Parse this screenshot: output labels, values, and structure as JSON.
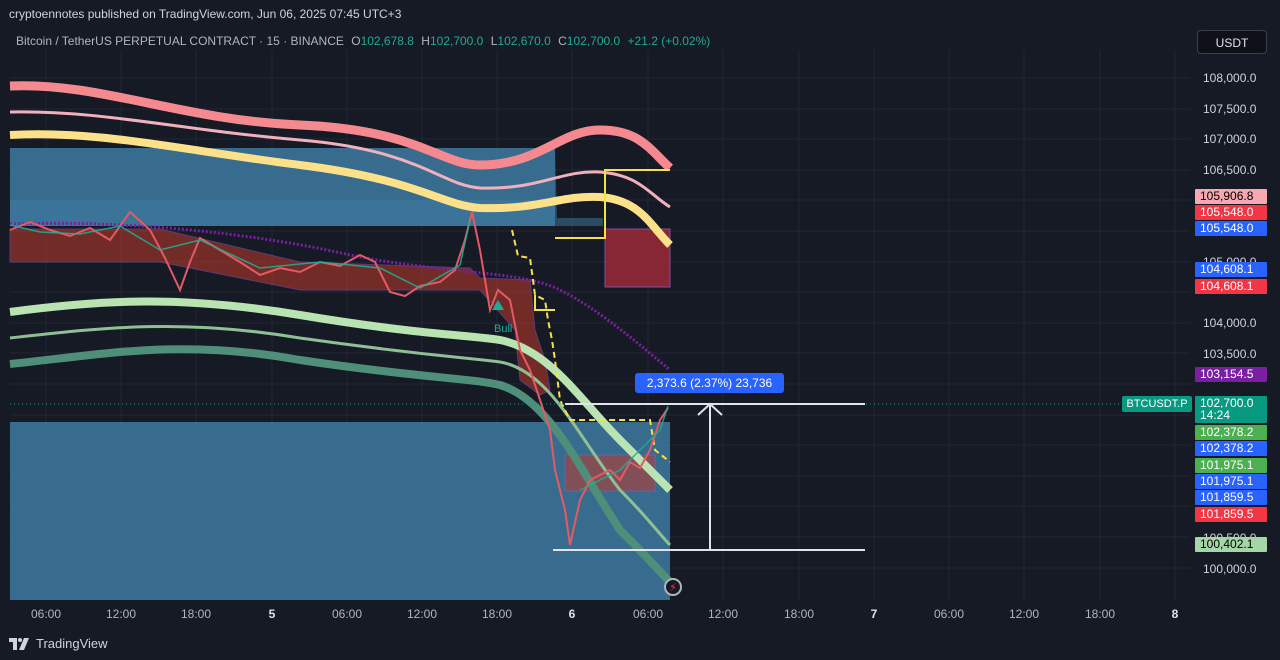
{
  "header": {
    "publisher_line": "cryptoennotes published on TradingView.com, Jun 06, 2025 07:45 UTC+3"
  },
  "legend": {
    "symbol": "Bitcoin / TetherUS PERPETUAL CONTRACT · 15 · BINANCE",
    "o_label": "O",
    "o_value": "102,678.8",
    "h_label": "H",
    "h_value": "102,700.0",
    "l_label": "L",
    "l_value": "102,670.0",
    "c_label": "C",
    "c_value": "102,700.0",
    "change": "+21.2 (+0.02%)"
  },
  "currency_button": "USDT",
  "y_axis_ticks": [
    "108,000.0",
    "107,500.0",
    "107,000.0",
    "106,500.0",
    "105,000.0",
    "104,000.0",
    "103,500.0",
    "100,500.0",
    "100,000.0"
  ],
  "price_labels": [
    {
      "text": "105,906.8",
      "color": "#f7a8b0",
      "text_color": "#000000"
    },
    {
      "text": "105,548.0",
      "color": "#f23645",
      "text_color": "#ffffff"
    },
    {
      "text": "105,548.0",
      "color": "#2962ff",
      "text_color": "#ffffff"
    },
    {
      "text": "104,608.1",
      "color": "#2962ff",
      "text_color": "#ffffff"
    },
    {
      "text": "104,608.1",
      "color": "#f23645",
      "text_color": "#ffffff"
    },
    {
      "text": "103,154.5",
      "color": "#7b1fa2",
      "text_color": "#ffffff"
    },
    {
      "text": "102,700.0",
      "color": "#089981",
      "text_color": "#ffffff"
    },
    {
      "text": "14:24",
      "color": "#089981",
      "text_color": "#ffffff"
    },
    {
      "text": "102,378.2",
      "color": "#4caf50",
      "text_color": "#ffffff"
    },
    {
      "text": "102,378.2",
      "color": "#2962ff",
      "text_color": "#ffffff"
    },
    {
      "text": "101,975.1",
      "color": "#4caf50",
      "text_color": "#ffffff"
    },
    {
      "text": "101,975.1",
      "color": "#2962ff",
      "text_color": "#ffffff"
    },
    {
      "text": "101,859.5",
      "color": "#2962ff",
      "text_color": "#ffffff"
    },
    {
      "text": "101,859.5",
      "color": "#f23645",
      "text_color": "#ffffff"
    },
    {
      "text": "100,402.1",
      "color": "#a5d6a7",
      "text_color": "#000000"
    }
  ],
  "x_axis_ticks": [
    {
      "text": "06:00",
      "bold": false
    },
    {
      "text": "12:00",
      "bold": false
    },
    {
      "text": "18:00",
      "bold": false
    },
    {
      "text": "5",
      "bold": true
    },
    {
      "text": "06:00",
      "bold": false
    },
    {
      "text": "12:00",
      "bold": false
    },
    {
      "text": "18:00",
      "bold": false
    },
    {
      "text": "6",
      "bold": true
    },
    {
      "text": "06:00",
      "bold": false
    },
    {
      "text": "12:00",
      "bold": false
    },
    {
      "text": "18:00",
      "bold": false
    },
    {
      "text": "7",
      "bold": true
    },
    {
      "text": "06:00",
      "bold": false
    },
    {
      "text": "12:00",
      "bold": false
    },
    {
      "text": "18:00",
      "bold": false
    },
    {
      "text": "8",
      "bold": true
    }
  ],
  "measure_label": "2,373.6 (2.37%) 23,736",
  "symbol_tag": "BTCUSDT.P",
  "signal_label": "Bull",
  "footer": {
    "brand": "TradingView"
  }
}
